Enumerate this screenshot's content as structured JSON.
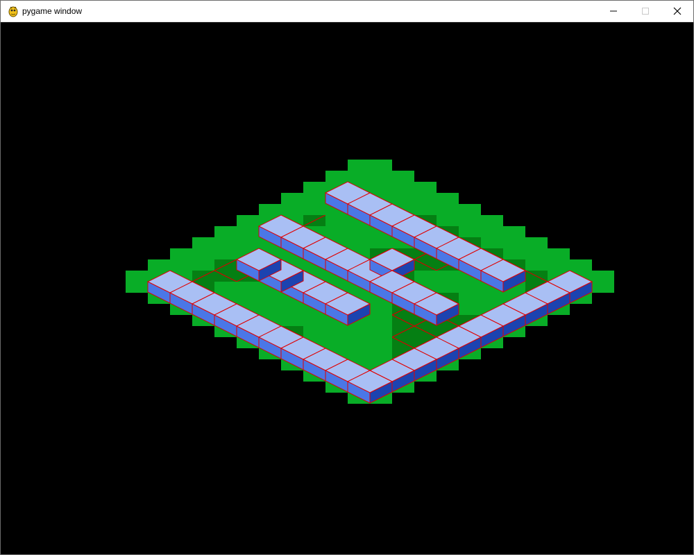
{
  "window": {
    "title": "pygame window",
    "icons": {
      "app": "pygame-snake-icon",
      "minimize": "minimize-icon",
      "maximize": "maximize-icon",
      "close": "close-icon"
    }
  },
  "scene": {
    "description_type": "isometric-tile-board",
    "colors": {
      "background": "#000000",
      "grass": "#09ad27",
      "grass_dark": "#057f13",
      "grid_line": "#d80000",
      "wall_top": "#a9bff4",
      "wall_front_light": "#4b77e6",
      "wall_front_dark": "#1c43b0",
      "wall_edge": "#e00000"
    }
  }
}
